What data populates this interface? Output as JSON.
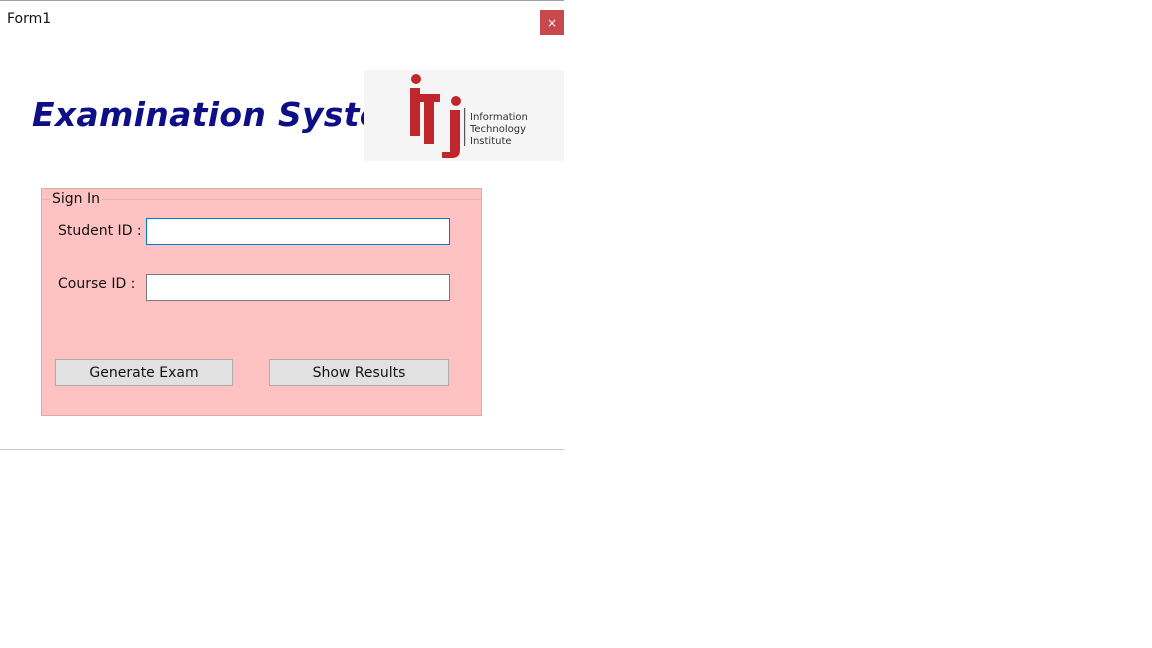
{
  "window": {
    "title": "Form1",
    "close_label": "×"
  },
  "header": {
    "app_title": "Examination System"
  },
  "logo": {
    "text_lines": [
      "Information",
      "Technology",
      "Institute"
    ],
    "brand_color": "#c0272d"
  },
  "signin": {
    "legend": "Sign In",
    "student_id_label": "Student ID :",
    "student_id_value": "",
    "course_id_label": "Course ID :",
    "course_id_value": "",
    "generate_button": "Generate Exam",
    "results_button": "Show Results"
  },
  "colors": {
    "title_color": "#0e0e87",
    "group_background": "#ffc2c2",
    "close_button": "#c8484c"
  }
}
